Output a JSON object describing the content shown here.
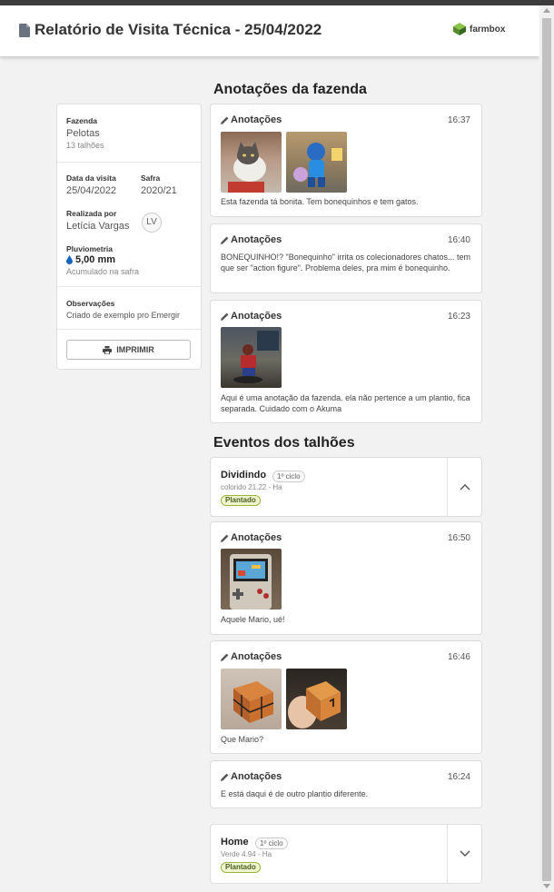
{
  "header": {
    "title": "Relatório de Visita Técnica - 25/04/2022",
    "logo_text": "farmbox",
    "brand_color": "#7cb342"
  },
  "sidebar": {
    "farm_label": "Fazenda",
    "farm_name": "Pelotas",
    "farm_fields": "13 talhões",
    "visit_date_label": "Data da visita",
    "visit_date": "25/04/2022",
    "season_label": "Safra",
    "season": "2020/21",
    "performed_by_label": "Realizada por",
    "performed_by": "Letícia Vargas",
    "avatar_initials": "LV",
    "rain_label": "Pluviometria",
    "rain_value": "5,00 mm",
    "rain_sub": "Acumulado na safra",
    "notes_label": "Observações",
    "notes": "Criado de exemplo pro Emergir",
    "print_label": "IMPRIMIR"
  },
  "farm_notes": {
    "title": "Anotações da fazenda",
    "items": [
      {
        "label": "Anotações",
        "time": "16:37",
        "text": "Esta fazenda tá bonita. Tem bonequinhos e tem gatos."
      },
      {
        "label": "Anotações",
        "time": "16:40",
        "text": "BONEQUINHO!? \"Bonequinho\" irrita os colecionadores chatos... tem que ser \"action figure\". Problema deles, pra mim é bonequinho."
      },
      {
        "label": "Anotações",
        "time": "16:23",
        "text": "Aqui é uma anotação da fazenda. ela não pertence a um plantio, fica separada. Cuidado com o Akuma"
      }
    ]
  },
  "field_events": {
    "title": "Eventos dos talhões",
    "fields": [
      {
        "name": "Dividindo",
        "cycle": "1º ciclo",
        "sub": "colorido 21.22 - Ha",
        "status": "Plantado",
        "notes": [
          {
            "label": "Anotações",
            "time": "16:50",
            "text": "Aquele Mario, ué!"
          },
          {
            "label": "Anotações",
            "time": "16:46",
            "text": "Que Mario?"
          },
          {
            "label": "Anotações",
            "time": "16:24",
            "text": "E está daqui é de outro plantio diferente."
          }
        ]
      },
      {
        "name": "Home",
        "cycle": "1º ciclo",
        "sub": "Verde 4.94 - Ha",
        "status": "Plantado"
      }
    ]
  }
}
